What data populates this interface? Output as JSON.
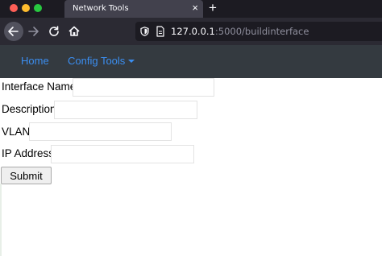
{
  "browser": {
    "tab_title": "Network Tools",
    "tab_close": "×",
    "new_tab": "+",
    "url_host": "127.0.0.1",
    "url_path": ":5000/buildinterface"
  },
  "site_nav": {
    "home": "Home",
    "config_tools": "Config Tools"
  },
  "form": {
    "interface_name_label": "Interface Name",
    "interface_name_value": "",
    "description_label": "Description",
    "description_value": "",
    "vlan_label": "VLAN",
    "vlan_value": "",
    "ip_address_label": "IP Address",
    "ip_address_value": "",
    "submit_label": "Submit"
  },
  "colors": {
    "tab_bar_bg": "#1c1b22",
    "toolbar_bg": "#2b2a33",
    "site_nav_bg": "#343a40",
    "link": "#3b8ef0"
  }
}
